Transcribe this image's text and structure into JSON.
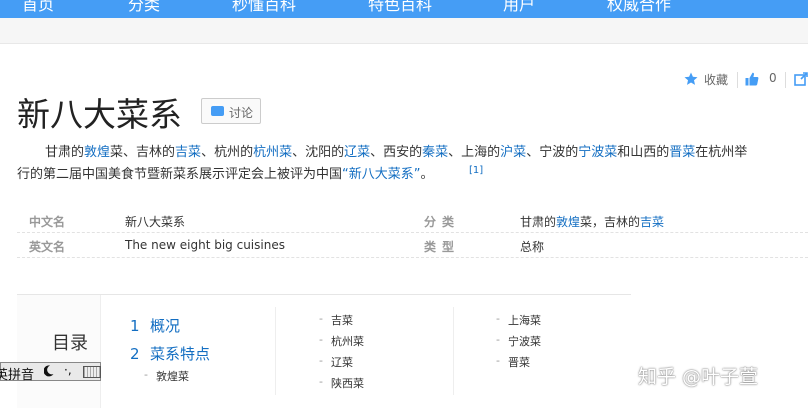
{
  "nav": {
    "items": [
      "首页",
      "分类",
      "秒懂百科",
      "特色百科",
      "用户",
      "权威合作"
    ]
  },
  "tools": {
    "favorite": "收藏",
    "like_count": "0"
  },
  "page": {
    "title": "新八大菜系",
    "discuss": "讨论"
  },
  "summary": {
    "l1": [
      {
        "t": "甘肃的",
        "link": false
      },
      {
        "t": "敦煌",
        "link": true
      },
      {
        "t": "菜、吉林的",
        "link": false
      },
      {
        "t": "吉菜",
        "link": true
      },
      {
        "t": "、杭州的",
        "link": false
      },
      {
        "t": "杭州菜",
        "link": true
      },
      {
        "t": "、沈阳的",
        "link": false
      },
      {
        "t": "辽菜",
        "link": true
      },
      {
        "t": "、西安的",
        "link": false
      },
      {
        "t": "秦菜",
        "link": true
      },
      {
        "t": "、上海的",
        "link": false
      },
      {
        "t": "沪菜",
        "link": true
      },
      {
        "t": "、宁波的",
        "link": false
      },
      {
        "t": "宁波菜",
        "link": true
      },
      {
        "t": "和山西的",
        "link": false
      },
      {
        "t": "晋菜",
        "link": true
      },
      {
        "t": "在杭州举",
        "link": false
      }
    ],
    "l2": [
      {
        "t": "行的第二届中国美食节暨新菜系展示评定会上被评为中国",
        "link": false
      },
      {
        "t": "“新八大菜系”",
        "link": true
      },
      {
        "t": "。",
        "link": false
      }
    ],
    "ref": "[1]"
  },
  "basic_info": {
    "rows": [
      {
        "k1": "中文名",
        "v1": "新八大菜系",
        "k2": "分类",
        "v2": [
          {
            "t": "甘肃的",
            "link": false
          },
          {
            "t": "敦煌",
            "link": true
          },
          {
            "t": "菜，吉林的",
            "link": false
          },
          {
            "t": "吉菜",
            "link": true
          }
        ]
      },
      {
        "k1": "英文名",
        "v1": "The new eight big cuisines",
        "k2": "类型",
        "v2": [
          {
            "t": "总称",
            "link": false
          }
        ]
      }
    ]
  },
  "toc": {
    "heading": "目录",
    "main": [
      {
        "n": "1",
        "label": "概况"
      },
      {
        "n": "2",
        "label": "菜系特点"
      }
    ],
    "sub_under_2": [
      "敦煌菜"
    ],
    "col2": [
      "吉菜",
      "杭州菜",
      "辽菜",
      "陕西菜"
    ],
    "col3": [
      "上海菜",
      "宁波菜",
      "晋菜"
    ]
  },
  "ime": {
    "label": "英拼音"
  },
  "watermark": "知乎 @叶子萱",
  "colors": {
    "nav_bg": "#459df5",
    "link": "#136ec2"
  }
}
